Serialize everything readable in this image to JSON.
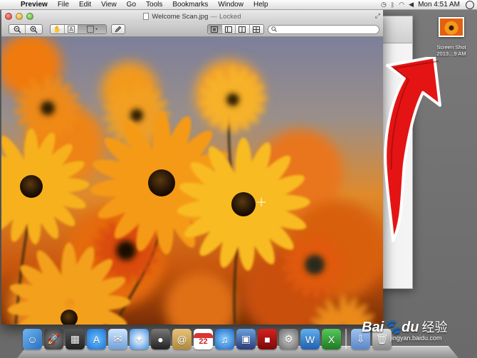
{
  "menubar": {
    "apple": "",
    "app_name": "Preview",
    "items": [
      "File",
      "Edit",
      "View",
      "Go",
      "Tools",
      "Bookmarks",
      "Window",
      "Help"
    ],
    "clock": "Mon 4:51 AM"
  },
  "window": {
    "title": "Welcome Scan.jpg",
    "title_separator": "—",
    "title_status": "Locked",
    "search_placeholder": ""
  },
  "desktop_icon": {
    "label_line1": "Screen Shot",
    "label_line2": "2013…9 AM"
  },
  "dock": {
    "calendar_day": "22"
  },
  "watermark": {
    "main": "Bai",
    "du": "du",
    "jingyan": "经验",
    "url": "jingyan.baidu.com"
  },
  "colors": {
    "arrow": "#e41414",
    "flower_orange": "#f08a12",
    "flower_yellow": "#f6b51a"
  }
}
